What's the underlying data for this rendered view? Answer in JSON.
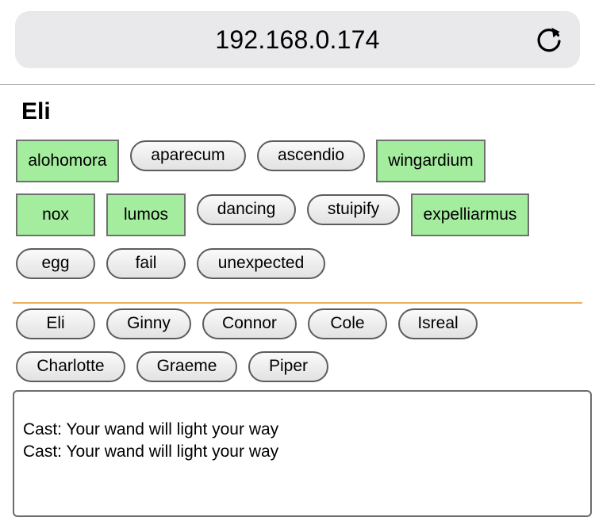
{
  "browser": {
    "url": "192.168.0.174",
    "reload_icon": "reload-icon"
  },
  "player": {
    "name": "Eli"
  },
  "spells": [
    {
      "label": "alohomora",
      "learned": true
    },
    {
      "label": "aparecum",
      "learned": false
    },
    {
      "label": "ascendio",
      "learned": false
    },
    {
      "label": "wingardium",
      "learned": true
    },
    {
      "label": "nox",
      "learned": true
    },
    {
      "label": "lumos",
      "learned": true
    },
    {
      "label": "dancing",
      "learned": false
    },
    {
      "label": "stuipify",
      "learned": false
    },
    {
      "label": "expelliarmus",
      "learned": true
    },
    {
      "label": "egg",
      "learned": false
    },
    {
      "label": "fail",
      "learned": false
    },
    {
      "label": "unexpected",
      "learned": false
    }
  ],
  "players": [
    "Eli",
    "Ginny",
    "Connor",
    "Cole",
    "Isreal",
    "Charlotte",
    "Graeme",
    "Piper"
  ],
  "log": [
    "Cast: Your wand will light your way",
    "Cast: Your wand will light your way"
  ],
  "colors": {
    "learned": "#a4ec9e",
    "divider": "#ebb05a",
    "url_bar": "#e9e9eb"
  }
}
